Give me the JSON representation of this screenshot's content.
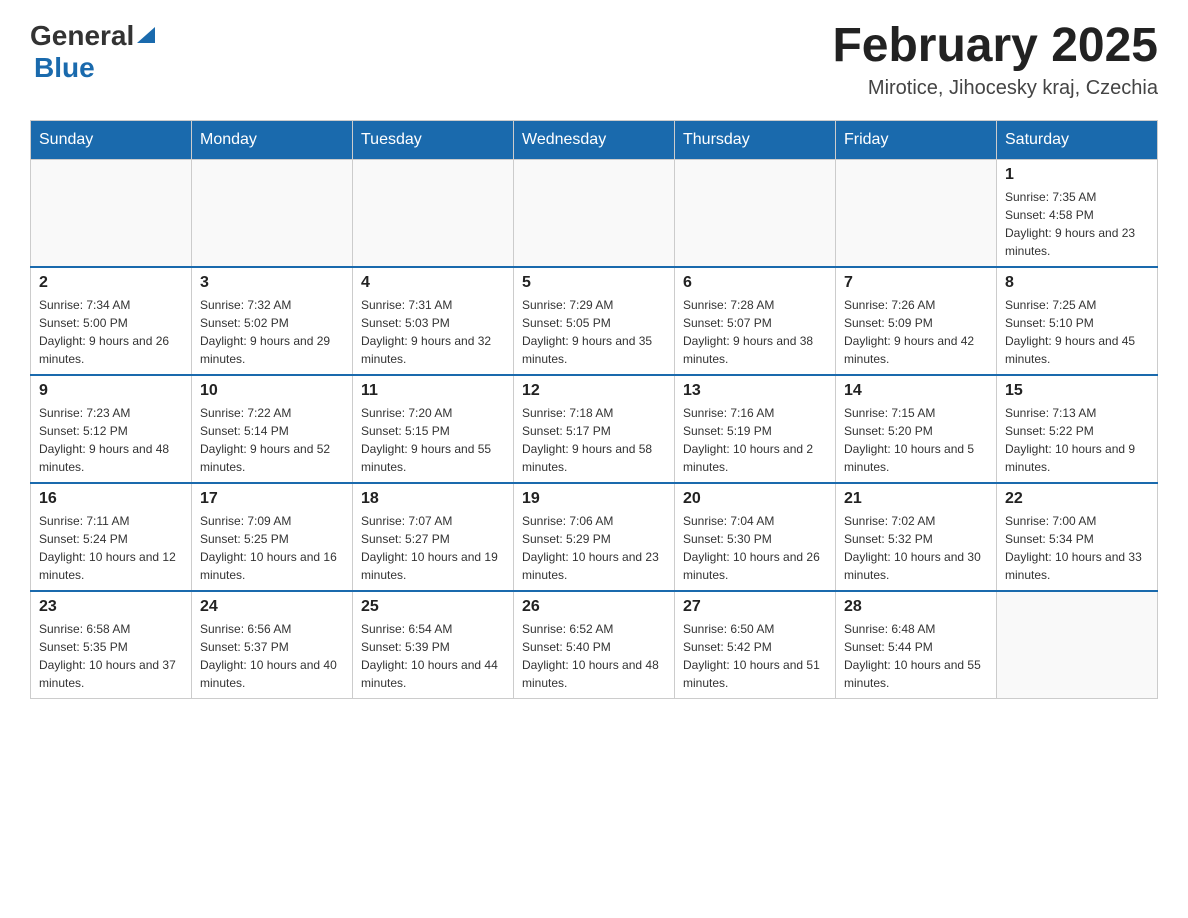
{
  "header": {
    "logo_general": "General",
    "logo_blue": "Blue",
    "month_title": "February 2025",
    "location": "Mirotice, Jihocesky kraj, Czechia"
  },
  "weekdays": [
    "Sunday",
    "Monday",
    "Tuesday",
    "Wednesday",
    "Thursday",
    "Friday",
    "Saturday"
  ],
  "weeks": [
    [
      {
        "day": "",
        "sunrise": "",
        "sunset": "",
        "daylight": ""
      },
      {
        "day": "",
        "sunrise": "",
        "sunset": "",
        "daylight": ""
      },
      {
        "day": "",
        "sunrise": "",
        "sunset": "",
        "daylight": ""
      },
      {
        "day": "",
        "sunrise": "",
        "sunset": "",
        "daylight": ""
      },
      {
        "day": "",
        "sunrise": "",
        "sunset": "",
        "daylight": ""
      },
      {
        "day": "",
        "sunrise": "",
        "sunset": "",
        "daylight": ""
      },
      {
        "day": "1",
        "sunrise": "Sunrise: 7:35 AM",
        "sunset": "Sunset: 4:58 PM",
        "daylight": "Daylight: 9 hours and 23 minutes."
      }
    ],
    [
      {
        "day": "2",
        "sunrise": "Sunrise: 7:34 AM",
        "sunset": "Sunset: 5:00 PM",
        "daylight": "Daylight: 9 hours and 26 minutes."
      },
      {
        "day": "3",
        "sunrise": "Sunrise: 7:32 AM",
        "sunset": "Sunset: 5:02 PM",
        "daylight": "Daylight: 9 hours and 29 minutes."
      },
      {
        "day": "4",
        "sunrise": "Sunrise: 7:31 AM",
        "sunset": "Sunset: 5:03 PM",
        "daylight": "Daylight: 9 hours and 32 minutes."
      },
      {
        "day": "5",
        "sunrise": "Sunrise: 7:29 AM",
        "sunset": "Sunset: 5:05 PM",
        "daylight": "Daylight: 9 hours and 35 minutes."
      },
      {
        "day": "6",
        "sunrise": "Sunrise: 7:28 AM",
        "sunset": "Sunset: 5:07 PM",
        "daylight": "Daylight: 9 hours and 38 minutes."
      },
      {
        "day": "7",
        "sunrise": "Sunrise: 7:26 AM",
        "sunset": "Sunset: 5:09 PM",
        "daylight": "Daylight: 9 hours and 42 minutes."
      },
      {
        "day": "8",
        "sunrise": "Sunrise: 7:25 AM",
        "sunset": "Sunset: 5:10 PM",
        "daylight": "Daylight: 9 hours and 45 minutes."
      }
    ],
    [
      {
        "day": "9",
        "sunrise": "Sunrise: 7:23 AM",
        "sunset": "Sunset: 5:12 PM",
        "daylight": "Daylight: 9 hours and 48 minutes."
      },
      {
        "day": "10",
        "sunrise": "Sunrise: 7:22 AM",
        "sunset": "Sunset: 5:14 PM",
        "daylight": "Daylight: 9 hours and 52 minutes."
      },
      {
        "day": "11",
        "sunrise": "Sunrise: 7:20 AM",
        "sunset": "Sunset: 5:15 PM",
        "daylight": "Daylight: 9 hours and 55 minutes."
      },
      {
        "day": "12",
        "sunrise": "Sunrise: 7:18 AM",
        "sunset": "Sunset: 5:17 PM",
        "daylight": "Daylight: 9 hours and 58 minutes."
      },
      {
        "day": "13",
        "sunrise": "Sunrise: 7:16 AM",
        "sunset": "Sunset: 5:19 PM",
        "daylight": "Daylight: 10 hours and 2 minutes."
      },
      {
        "day": "14",
        "sunrise": "Sunrise: 7:15 AM",
        "sunset": "Sunset: 5:20 PM",
        "daylight": "Daylight: 10 hours and 5 minutes."
      },
      {
        "day": "15",
        "sunrise": "Sunrise: 7:13 AM",
        "sunset": "Sunset: 5:22 PM",
        "daylight": "Daylight: 10 hours and 9 minutes."
      }
    ],
    [
      {
        "day": "16",
        "sunrise": "Sunrise: 7:11 AM",
        "sunset": "Sunset: 5:24 PM",
        "daylight": "Daylight: 10 hours and 12 minutes."
      },
      {
        "day": "17",
        "sunrise": "Sunrise: 7:09 AM",
        "sunset": "Sunset: 5:25 PM",
        "daylight": "Daylight: 10 hours and 16 minutes."
      },
      {
        "day": "18",
        "sunrise": "Sunrise: 7:07 AM",
        "sunset": "Sunset: 5:27 PM",
        "daylight": "Daylight: 10 hours and 19 minutes."
      },
      {
        "day": "19",
        "sunrise": "Sunrise: 7:06 AM",
        "sunset": "Sunset: 5:29 PM",
        "daylight": "Daylight: 10 hours and 23 minutes."
      },
      {
        "day": "20",
        "sunrise": "Sunrise: 7:04 AM",
        "sunset": "Sunset: 5:30 PM",
        "daylight": "Daylight: 10 hours and 26 minutes."
      },
      {
        "day": "21",
        "sunrise": "Sunrise: 7:02 AM",
        "sunset": "Sunset: 5:32 PM",
        "daylight": "Daylight: 10 hours and 30 minutes."
      },
      {
        "day": "22",
        "sunrise": "Sunrise: 7:00 AM",
        "sunset": "Sunset: 5:34 PM",
        "daylight": "Daylight: 10 hours and 33 minutes."
      }
    ],
    [
      {
        "day": "23",
        "sunrise": "Sunrise: 6:58 AM",
        "sunset": "Sunset: 5:35 PM",
        "daylight": "Daylight: 10 hours and 37 minutes."
      },
      {
        "day": "24",
        "sunrise": "Sunrise: 6:56 AM",
        "sunset": "Sunset: 5:37 PM",
        "daylight": "Daylight: 10 hours and 40 minutes."
      },
      {
        "day": "25",
        "sunrise": "Sunrise: 6:54 AM",
        "sunset": "Sunset: 5:39 PM",
        "daylight": "Daylight: 10 hours and 44 minutes."
      },
      {
        "day": "26",
        "sunrise": "Sunrise: 6:52 AM",
        "sunset": "Sunset: 5:40 PM",
        "daylight": "Daylight: 10 hours and 48 minutes."
      },
      {
        "day": "27",
        "sunrise": "Sunrise: 6:50 AM",
        "sunset": "Sunset: 5:42 PM",
        "daylight": "Daylight: 10 hours and 51 minutes."
      },
      {
        "day": "28",
        "sunrise": "Sunrise: 6:48 AM",
        "sunset": "Sunset: 5:44 PM",
        "daylight": "Daylight: 10 hours and 55 minutes."
      },
      {
        "day": "",
        "sunrise": "",
        "sunset": "",
        "daylight": ""
      }
    ]
  ]
}
